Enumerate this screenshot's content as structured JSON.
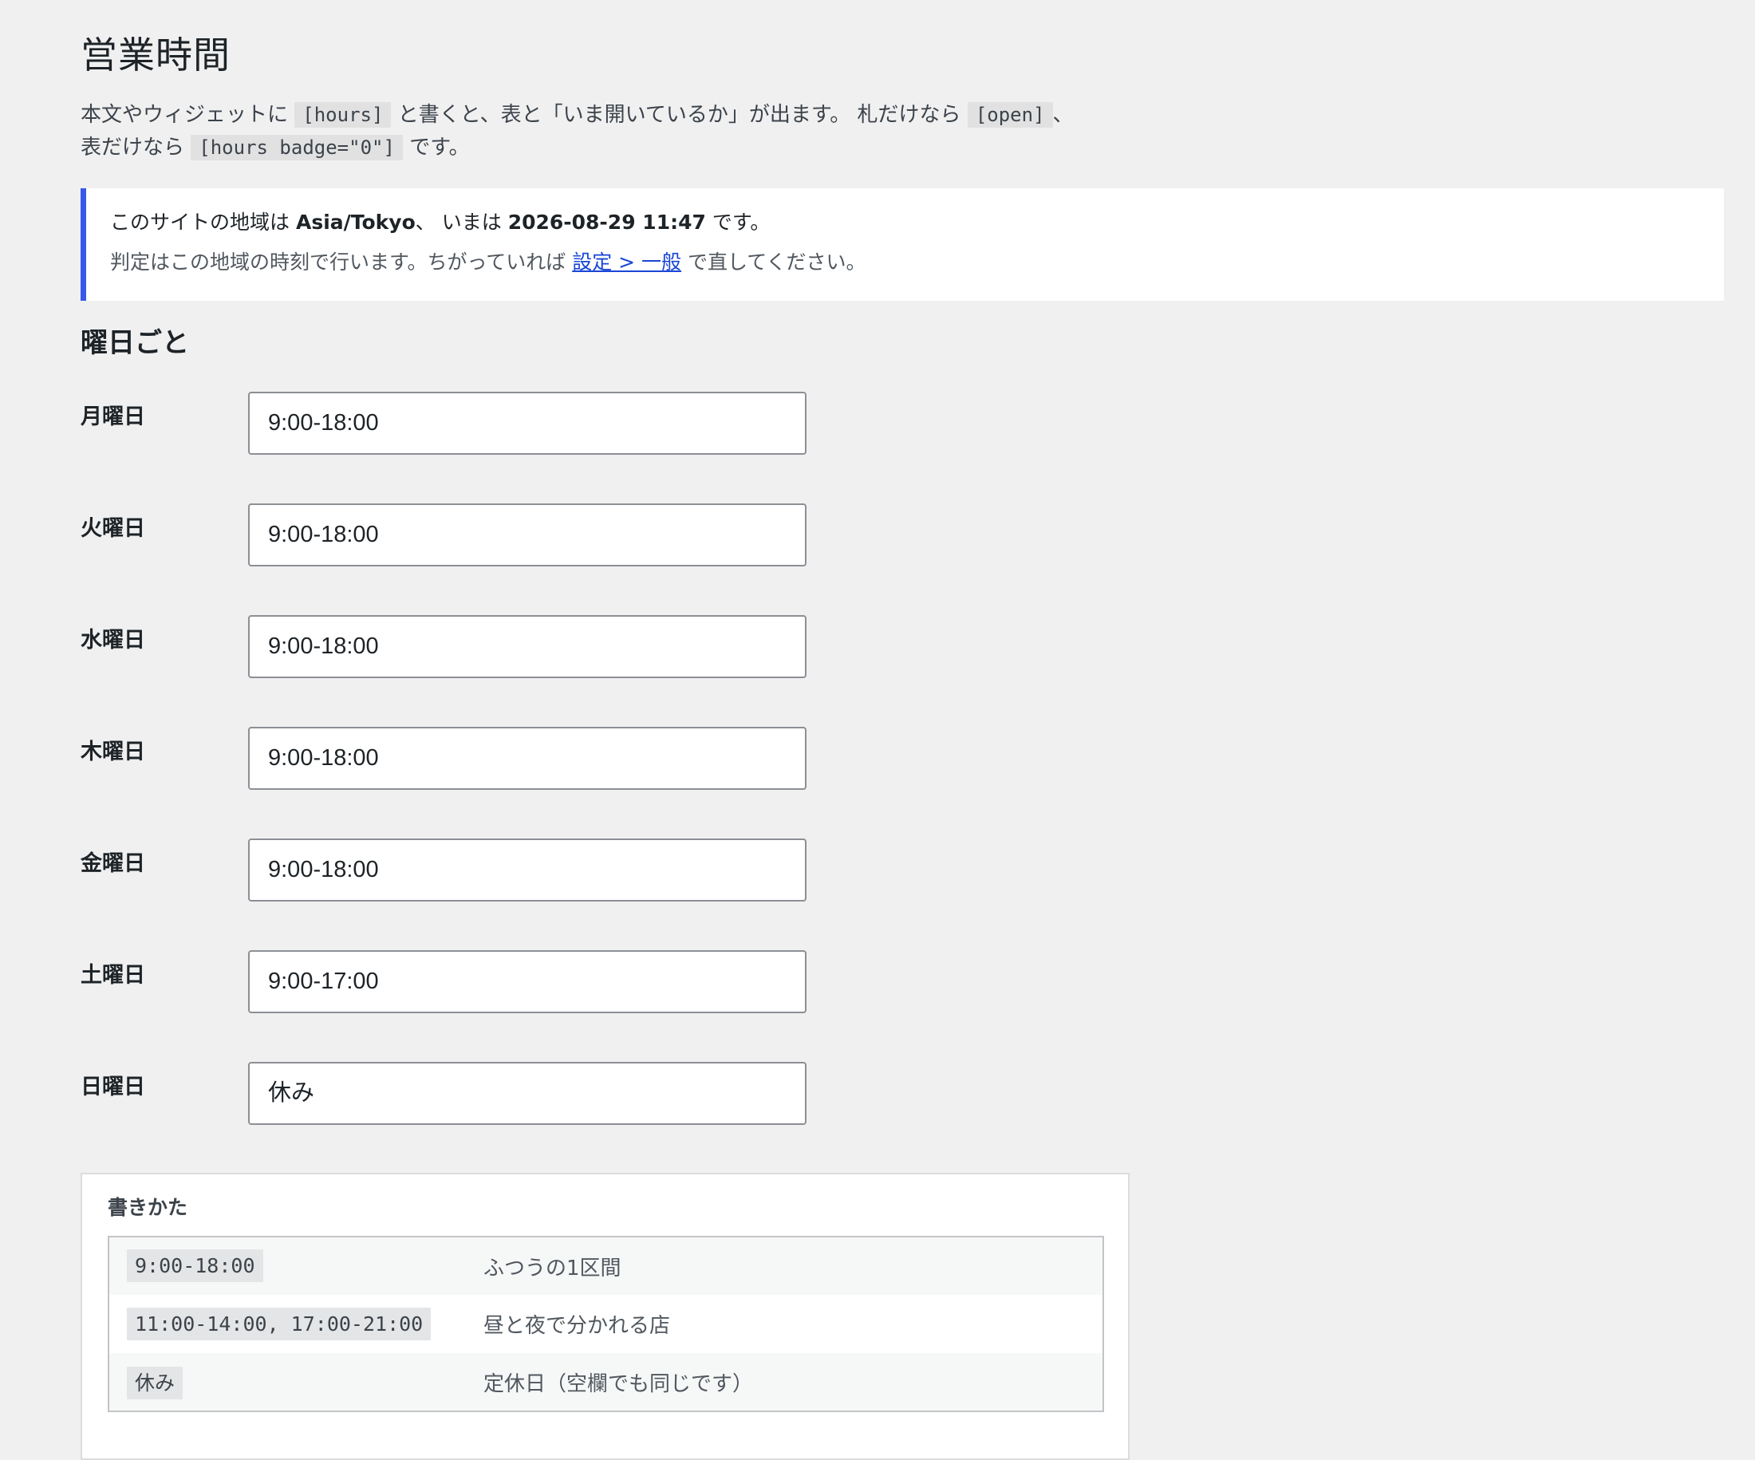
{
  "page": {
    "title": "営業時間"
  },
  "intro": {
    "text1": "本文やウィジェットに",
    "code1": "[hours]",
    "text2": "と書くと、表と「いま開いているか」が出ます。 札だけなら",
    "code2": "[open]",
    "text3": "、",
    "text4": "表だけなら",
    "code3": "[hours badge=\"0\"]",
    "text5": "です。"
  },
  "notice": {
    "line1_prefix": "このサイトの地域は",
    "timezone": "Asia/Tokyo",
    "line1_mid": "、 いまは",
    "now": "2026-08-29 11:47",
    "line1_suffix": "です。",
    "line2_prefix": "判定はこの地域の時刻で行います。ちがっていれば",
    "link": "設定 > 一般",
    "line2_suffix": "で直してください。"
  },
  "weekly": {
    "heading": "曜日ごと",
    "days": [
      {
        "label": "月曜日",
        "value": "9:00-18:00"
      },
      {
        "label": "火曜日",
        "value": "9:00-18:00"
      },
      {
        "label": "水曜日",
        "value": "9:00-18:00"
      },
      {
        "label": "木曜日",
        "value": "9:00-18:00"
      },
      {
        "label": "金曜日",
        "value": "9:00-18:00"
      },
      {
        "label": "土曜日",
        "value": "9:00-17:00"
      },
      {
        "label": "日曜日",
        "value": "休み"
      }
    ]
  },
  "howto": {
    "heading": "書きかた",
    "rows": [
      {
        "code": "9:00-18:00",
        "desc": "ふつうの1区間"
      },
      {
        "code": "11:00-14:00, 17:00-21:00",
        "desc": "昼と夜で分かれる店"
      },
      {
        "code": "休み",
        "desc": "定休日（空欄でも同じです）"
      }
    ]
  },
  "colors": {
    "background": "#f0f0f1",
    "notice_accent": "#3858e9",
    "link": "#1846d6"
  }
}
